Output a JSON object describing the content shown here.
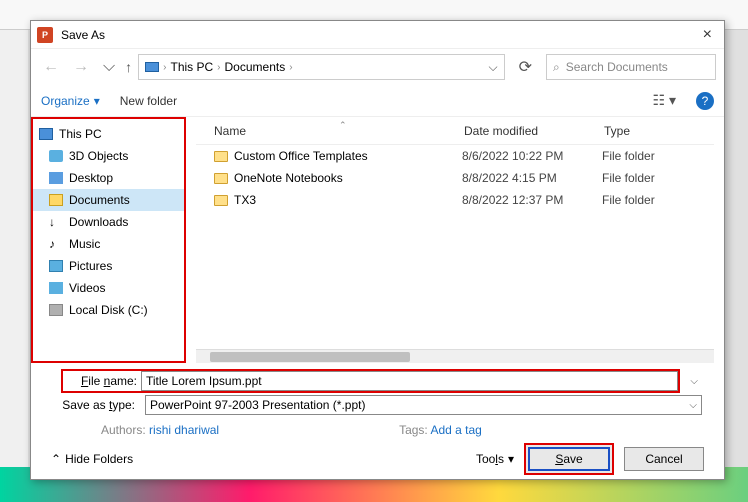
{
  "dialog": {
    "title": "Save As",
    "close": "×"
  },
  "nav": {
    "back": "←",
    "forward": "→",
    "up": "↑",
    "crumb1": "This PC",
    "crumb2": "Documents",
    "addr_drop": "⌵",
    "refresh": "⟳"
  },
  "search": {
    "placeholder": "Search Documents",
    "icon": "⌕"
  },
  "toolbar": {
    "organize": "Organize",
    "organize_caret": "▾",
    "new_folder": "New folder",
    "view_icon": "☷",
    "view_caret": "▾",
    "help": "?"
  },
  "tree": {
    "items": [
      {
        "label": "This PC",
        "ico": "ico-pc"
      },
      {
        "label": "3D Objects",
        "ico": "ico-3d"
      },
      {
        "label": "Desktop",
        "ico": "ico-desk"
      },
      {
        "label": "Documents",
        "ico": "ico-doc",
        "sel": true
      },
      {
        "label": "Downloads",
        "ico": "ico-down",
        "glyph": "↓"
      },
      {
        "label": "Music",
        "ico": "ico-music",
        "glyph": "♪"
      },
      {
        "label": "Pictures",
        "ico": "ico-pic"
      },
      {
        "label": "Videos",
        "ico": "ico-vid"
      },
      {
        "label": "Local Disk (C:)",
        "ico": "ico-disk"
      }
    ]
  },
  "columns": {
    "name": "Name",
    "date": "Date modified",
    "type": "Type",
    "caret": "⌃"
  },
  "rows": [
    {
      "name": "Custom Office Templates",
      "date": "8/6/2022 10:22 PM",
      "type": "File folder"
    },
    {
      "name": "OneNote Notebooks",
      "date": "8/8/2022 4:15 PM",
      "type": "File folder"
    },
    {
      "name": "TX3",
      "date": "8/8/2022 12:37 PM",
      "type": "File folder"
    }
  ],
  "form": {
    "fname_label": "File name:",
    "fname_value": "Title Lorem Ipsum.ppt",
    "type_label": "Save as type:",
    "type_value": "PowerPoint 97-2003 Presentation (*.ppt)"
  },
  "meta": {
    "authors_label": "Authors:",
    "authors_value": "rishi dhariwal",
    "tags_label": "Tags:",
    "tags_value": "Add a tag"
  },
  "footer": {
    "hide_caret": "⌃",
    "hide_label": "Hide Folders",
    "tools": "Tools",
    "tools_caret": "▾",
    "save": "Save",
    "cancel": "Cancel"
  }
}
